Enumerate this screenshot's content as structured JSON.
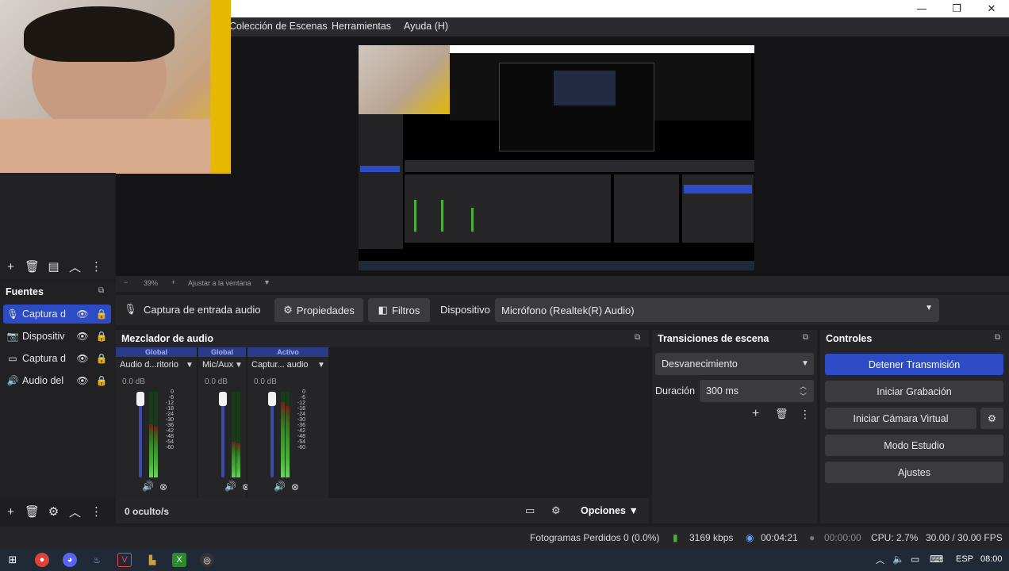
{
  "menubar": {
    "items": [
      "Colección de Escenas",
      "Herramientas",
      "Ayuda (H)"
    ]
  },
  "window_controls": {
    "minimize": "—",
    "maximize": "❐",
    "close": "✕"
  },
  "zoom": {
    "minus": "−",
    "value": "39%",
    "plus": "+",
    "fit": "Ajustar a la ventana"
  },
  "sources": {
    "title": "Fuentes",
    "items": [
      {
        "name": "Captura d",
        "icon": "mic-icon",
        "selected": true
      },
      {
        "name": "Dispositiv",
        "icon": "camera-icon",
        "selected": false
      },
      {
        "name": "Captura d",
        "icon": "monitor-icon",
        "selected": false
      },
      {
        "name": "Audio del",
        "icon": "speaker-icon",
        "selected": false
      }
    ]
  },
  "context": {
    "source_name": "Captura de entrada audio",
    "properties": "Propiedades",
    "filters": "Filtros",
    "device_label": "Dispositivo",
    "device_value": "Micrófono (Realtek(R) Audio)"
  },
  "mixer": {
    "title": "Mezclador de audio",
    "hidden": "0 oculto/s",
    "options": "Opciones",
    "scale": [
      "0",
      "-6",
      "-12",
      "-18",
      "-24",
      "-30",
      "-36",
      "-42",
      "-48",
      "-54",
      "-60"
    ],
    "channels": [
      {
        "head": "Global",
        "name": "Audio d...ritorio",
        "db": "0.0 dB",
        "level": 0.62
      },
      {
        "head": "Global",
        "name": "Mic/Aux",
        "db": "0.0 dB",
        "level": 0.42
      },
      {
        "head": "Activo",
        "name": "Captur... audio",
        "db": "0.0 dB",
        "level": 0.88
      }
    ]
  },
  "transitions": {
    "title": "Transiciones de escena",
    "selected": "Desvanecimiento",
    "duration_label": "Duración",
    "duration_value": "300 ms"
  },
  "controls": {
    "title": "Controles",
    "buttons": [
      "Detener Transmisión",
      "Iniciar Grabación",
      "Iniciar Cámara Virtual",
      "Modo Estudio",
      "Ajustes"
    ]
  },
  "status": {
    "dropped": "Fotogramas Perdidos 0 (0.0%)",
    "bitrate": "3169 kbps",
    "stream_time": "00:04:21",
    "rec_time": "00:00:00",
    "cpu": "CPU: 2.7%",
    "fps": "30.00 / 30.00 FPS"
  },
  "taskbar": {
    "lang": "ESP",
    "time": "08:00"
  },
  "colors": {
    "accent": "#2c4bc4",
    "panel": "#262629",
    "meter_green": "#4caf3a",
    "meter_red": "#8b1c22"
  }
}
